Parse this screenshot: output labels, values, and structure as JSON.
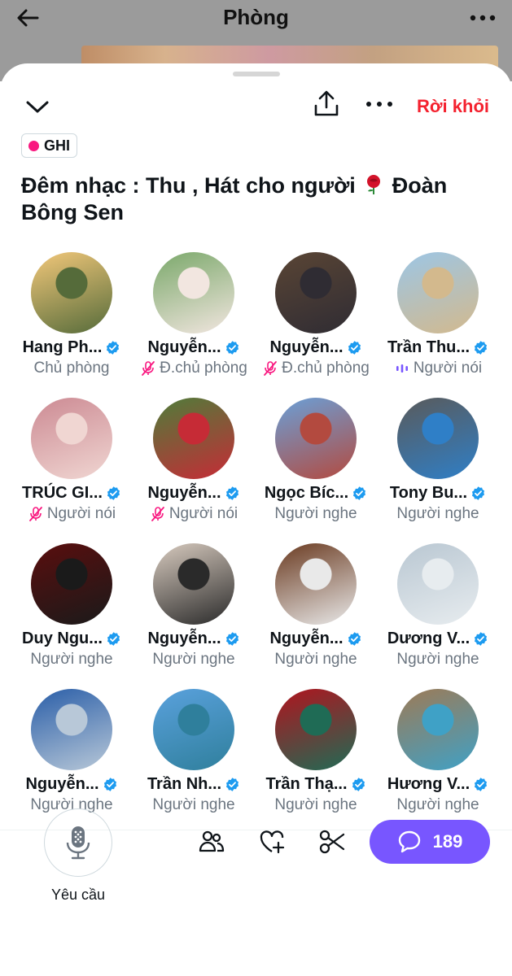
{
  "topbar": {
    "title": "Phòng"
  },
  "sheet": {
    "leave_label": "Rời khỏi",
    "rec_label": "GHI",
    "title_part1": "Đêm nhạc : Thu , Hát cho người",
    "title_part2": "Đoàn Bông Sen"
  },
  "participants": [
    {
      "name": "Hang Ph...",
      "role": "Chủ phòng",
      "role_icon": "none",
      "colors": [
        "#f3c87a",
        "#556b3a"
      ]
    },
    {
      "name": "Nguyễn...",
      "role": "Đ.chủ phòng",
      "role_icon": "muted-mic-icon",
      "colors": [
        "#7aa86a",
        "#f2e6e0"
      ]
    },
    {
      "name": "Nguyễn...",
      "role": "Đ.chủ phòng",
      "role_icon": "muted-mic-icon",
      "colors": [
        "#5a4535",
        "#2f2c33"
      ]
    },
    {
      "name": "Trần Thu...",
      "role": "Người nói",
      "role_icon": "speaking-icon",
      "colors": [
        "#9cc6e6",
        "#d3b98d"
      ]
    },
    {
      "name": "TRÚC GI...",
      "role": "Người nói",
      "role_icon": "muted-mic-icon",
      "colors": [
        "#cc8a93",
        "#f0d6d2"
      ]
    },
    {
      "name": "Nguyễn...",
      "role": "Người nói",
      "role_icon": "muted-mic-icon",
      "colors": [
        "#4e7d3a",
        "#c62b36"
      ]
    },
    {
      "name": "Ngọc Bíc...",
      "role": "Người nghe",
      "role_icon": "none",
      "colors": [
        "#6aa0d8",
        "#b34a3f"
      ]
    },
    {
      "name": "Tony Bu...",
      "role": "Người nghe",
      "role_icon": "none",
      "colors": [
        "#5a5a5a",
        "#2f7fc7"
      ]
    },
    {
      "name": "Duy Ngu...",
      "role": "Người nghe",
      "role_icon": "none",
      "colors": [
        "#5a0e0e",
        "#1a1a1a"
      ]
    },
    {
      "name": "Nguyễn...",
      "role": "Người nghe",
      "role_icon": "none",
      "colors": [
        "#d8cbbf",
        "#2a2a2a"
      ]
    },
    {
      "name": "Nguyễn...",
      "role": "Người nghe",
      "role_icon": "none",
      "colors": [
        "#6a3a20",
        "#e9e9e9"
      ]
    },
    {
      "name": "Dương V...",
      "role": "Người nghe",
      "role_icon": "none",
      "colors": [
        "#b9c7d2",
        "#e7ecef"
      ]
    },
    {
      "name": "Nguyễn...",
      "role": "Người nghe",
      "role_icon": "none",
      "colors": [
        "#2a5ea8",
        "#b8c8d8"
      ]
    },
    {
      "name": "Trần Nh...",
      "role": "Người nghe",
      "role_icon": "none",
      "colors": [
        "#5aa1dd",
        "#2f7f9c"
      ]
    },
    {
      "name": "Trần Thạ...",
      "role": "Người nghe",
      "role_icon": "none",
      "colors": [
        "#b1141e",
        "#1f6b55"
      ]
    },
    {
      "name": "Hương V...",
      "role": "Người nghe",
      "role_icon": "none",
      "colors": [
        "#9e7a55",
        "#3fa1c6"
      ]
    }
  ],
  "bottom": {
    "request_label": "Yêu cầu",
    "chat_count": "189"
  },
  "colors": {
    "accent": "#7856ff",
    "verified": "#1d9bf0",
    "leave": "#f4212e",
    "rec": "#f91880",
    "muted_mic": "#f91880",
    "speaking": "#7856ff"
  }
}
